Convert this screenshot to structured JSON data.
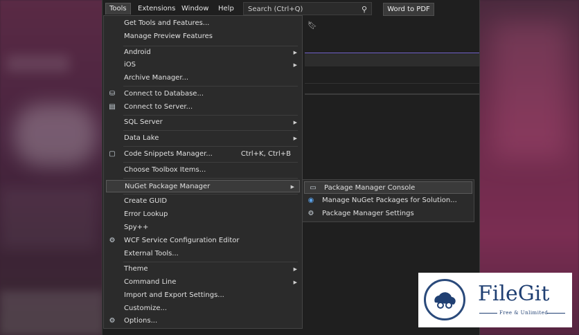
{
  "menubar": {
    "items": [
      {
        "label": "Tools",
        "active": true
      },
      {
        "label": "Extensions"
      },
      {
        "label": "Window"
      },
      {
        "label": "Help"
      }
    ],
    "search_placeholder": "Search (Ctrl+Q)",
    "word_to_pdf": "Word to PDF"
  },
  "tools_menu": {
    "items": [
      {
        "label": "Get Tools and Features..."
      },
      {
        "label": "Manage Preview Features"
      },
      {
        "label": "Android",
        "submenu": true
      },
      {
        "label": "iOS",
        "submenu": true
      },
      {
        "label": "Archive Manager..."
      },
      {
        "label": "Connect to Database...",
        "icon": "database-connect-icon"
      },
      {
        "label": "Connect to Server...",
        "icon": "server-connect-icon"
      },
      {
        "label": "SQL Server",
        "submenu": true
      },
      {
        "label": "Data Lake",
        "submenu": true
      },
      {
        "label": "Code Snippets Manager...",
        "shortcut": "Ctrl+K, Ctrl+B",
        "icon": "snippet-icon"
      },
      {
        "label": "Choose Toolbox Items..."
      },
      {
        "label": "NuGet Package Manager",
        "submenu": true,
        "highlighted": true
      },
      {
        "label": "Create GUID"
      },
      {
        "label": "Error Lookup"
      },
      {
        "label": "Spy++"
      },
      {
        "label": "WCF Service Configuration Editor",
        "icon": "wcf-config-icon"
      },
      {
        "label": "External Tools..."
      },
      {
        "label": "Theme",
        "submenu": true
      },
      {
        "label": "Command Line",
        "submenu": true
      },
      {
        "label": "Import and Export Settings..."
      },
      {
        "label": "Customize..."
      },
      {
        "label": "Options...",
        "icon": "gear-icon"
      }
    ]
  },
  "nuget_submenu": {
    "items": [
      {
        "label": "Package Manager Console",
        "icon": "console-icon",
        "highlighted": true
      },
      {
        "label": "Manage NuGet Packages for Solution...",
        "icon": "nuget-icon"
      },
      {
        "label": "Package Manager Settings",
        "icon": "gear-icon"
      }
    ]
  },
  "watermark": {
    "name": "FileGit",
    "tagline": "Free & Unlimited"
  },
  "colors": {
    "menu_bg": "#2b2b2b",
    "accent_line": "#7a6bd6",
    "brand": "#1f3f72"
  }
}
